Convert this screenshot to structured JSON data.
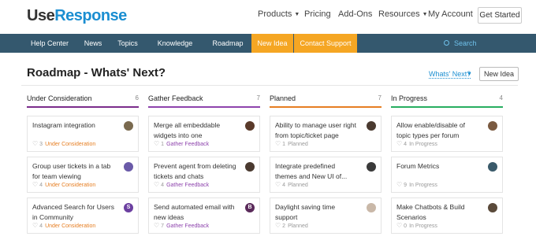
{
  "header": {
    "logo_use": "Use",
    "logo_response": "Response",
    "nav": [
      {
        "label": "Products",
        "caret": true
      },
      {
        "label": "Pricing",
        "caret": false
      },
      {
        "label": "Add-Ons",
        "caret": false
      },
      {
        "label": "Resources",
        "caret": true
      },
      {
        "label": "My Account",
        "caret": false
      }
    ],
    "get_started": "Get Started"
  },
  "navbar": {
    "items": [
      "Help Center",
      "News",
      "Topics",
      "Knowledge Base",
      "Roadmap",
      "New Idea",
      "Contact Support"
    ],
    "highlighted": [
      "New Idea",
      "Contact Support"
    ],
    "search_placeholder": "Search"
  },
  "page": {
    "title": "Roadmap - Whats' Next?",
    "sort_label": "Whats' Next?",
    "new_idea_button": "New Idea"
  },
  "columns": [
    {
      "name": "Under Consideration",
      "count": "6",
      "color": "#7b2d8b",
      "status_color": "#e67e22",
      "cards": [
        {
          "title": "Instagram integration",
          "likes": "3",
          "status": "Under Consideration",
          "avatar": "photo",
          "avatar_color": "#7a6a4f"
        },
        {
          "title": "Group user tickets in a tab for team viewing",
          "likes": "4",
          "status": "Under Consideration",
          "avatar": "photo",
          "avatar_color": "#6a5aa8"
        },
        {
          "title": "Advanced Search for Users in Community",
          "likes": "4",
          "status": "Under Consideration",
          "avatar": "S",
          "avatar_color": "#6b3fa0"
        }
      ]
    },
    {
      "name": "Gather Feedback",
      "count": "7",
      "color": "#8e44ad",
      "status_color": "#8e44ad",
      "cards": [
        {
          "title": "Merge all embeddable widgets into one",
          "likes": "1",
          "status": "Gather Feedback",
          "avatar": "photo",
          "avatar_color": "#5a3a2a"
        },
        {
          "title": "Prevent agent from deleting tickets and chats",
          "likes": "4",
          "status": "Gather Feedback",
          "avatar": "photo",
          "avatar_color": "#4a3a30"
        },
        {
          "title": "Send automated email with new ideas",
          "likes": "7",
          "status": "Gather Feedback",
          "avatar": "B",
          "avatar_color": "#5a2a5a"
        }
      ]
    },
    {
      "name": "Planned",
      "count": "7",
      "color": "#e67e22",
      "status_color": "#999999",
      "cards": [
        {
          "title": "Ability to manage user right from topic/ticket page",
          "likes": "1",
          "status": "Planned",
          "avatar": "photo",
          "avatar_color": "#4a3a30"
        },
        {
          "title": "Integrate predefined themes and New UI of...",
          "likes": "4",
          "status": "Planned",
          "avatar": "photo",
          "avatar_color": "#3a3a3a"
        },
        {
          "title": "Daylight saving time support",
          "likes": "2",
          "status": "Planned",
          "avatar": "photo",
          "avatar_color": "#c9b8a8"
        }
      ]
    },
    {
      "name": "In Progress",
      "count": "4",
      "color": "#27ae60",
      "status_color": "#999999",
      "cards": [
        {
          "title": "Allow enable/disable of topic types per forum",
          "likes": "4",
          "status": "In Progress",
          "avatar": "photo",
          "avatar_color": "#7a5a40"
        },
        {
          "title": "Forum Metrics",
          "likes": "9",
          "status": "In Progress",
          "avatar": "photo",
          "avatar_color": "#3a5a6a"
        },
        {
          "title": "Make Chatbots & Build Scenarios",
          "likes": "0",
          "status": "In Progress",
          "avatar": "photo",
          "avatar_color": "#5a4a3a"
        }
      ]
    }
  ]
}
